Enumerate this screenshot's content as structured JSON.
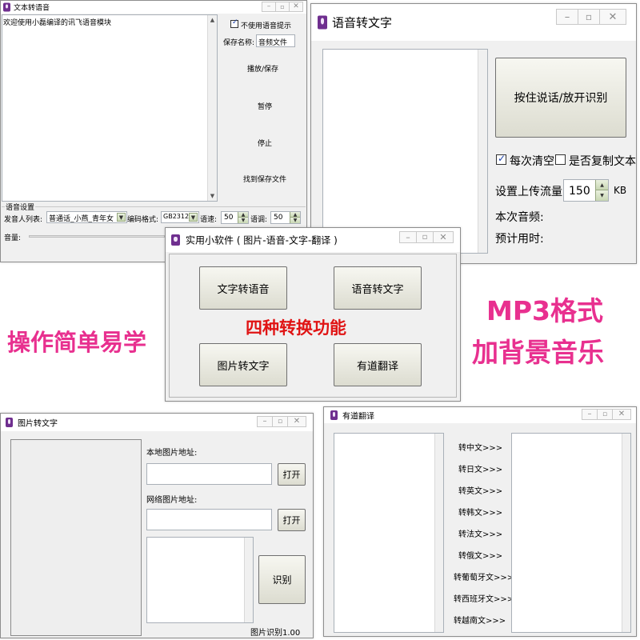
{
  "colors": {
    "promo_pink": "#e8308f",
    "center_red": "#e01414",
    "title_icon": "#6f2f8f"
  },
  "tts": {
    "title": "文本转语音",
    "textarea": "欢迎使用小磊编译的讯飞语音模块",
    "disable_label": "不使用语音提示",
    "save_name_label": "保存名称:",
    "save_name_value": "音频文件",
    "play_save": "播放/保存",
    "pause": "暂停",
    "stop": "停止",
    "find_file": "找到保存文件",
    "group_label": "语音设置",
    "speaker_label": "发音人列表:",
    "speaker_value": "普通话_小燕_青年女",
    "encoding_label": "编码格式:",
    "encoding_value": "GB2312",
    "speed_label": "语速:",
    "speed_value": "50",
    "pitch_label": "语调:",
    "pitch_value": "50",
    "volume_label": "音量:"
  },
  "stt": {
    "title": "语音转文字",
    "record_button": "按住说话/放开识别",
    "clear_label": "每次清空",
    "copy_label": "是否复制文本",
    "upload_label": "设置上传流量:",
    "upload_value": "150",
    "upload_unit": "KB",
    "audio_label": "本次音频:",
    "time_label": "预计用时:"
  },
  "main": {
    "title": "实用小软件 ( 图片-语音-文字-翻译 )",
    "btn_tts": "文字转语音",
    "btn_stt": "语音转文字",
    "btn_ocr": "图片转文字",
    "btn_translate": "有道翻译",
    "center_text": "四种转换功能"
  },
  "promo": {
    "left": "操作简单易学",
    "right_line1": "MP3格式",
    "right_line2": "加背景音乐"
  },
  "ocr": {
    "title": "图片转文字",
    "local_label": "本地图片地址:",
    "open1": "打开",
    "network_label": "网络图片地址:",
    "open2": "打开",
    "recognize": "识别",
    "version": "图片识别1.00"
  },
  "translate": {
    "title": "有道翻译",
    "buttons": [
      "转中文>>>",
      "转日文>>>",
      "转英文>>>",
      "转韩文>>>",
      "转法文>>>",
      "转俄文>>>",
      "转葡萄牙文>>>",
      "转西班牙文>>>",
      "转越南文>>>"
    ]
  }
}
